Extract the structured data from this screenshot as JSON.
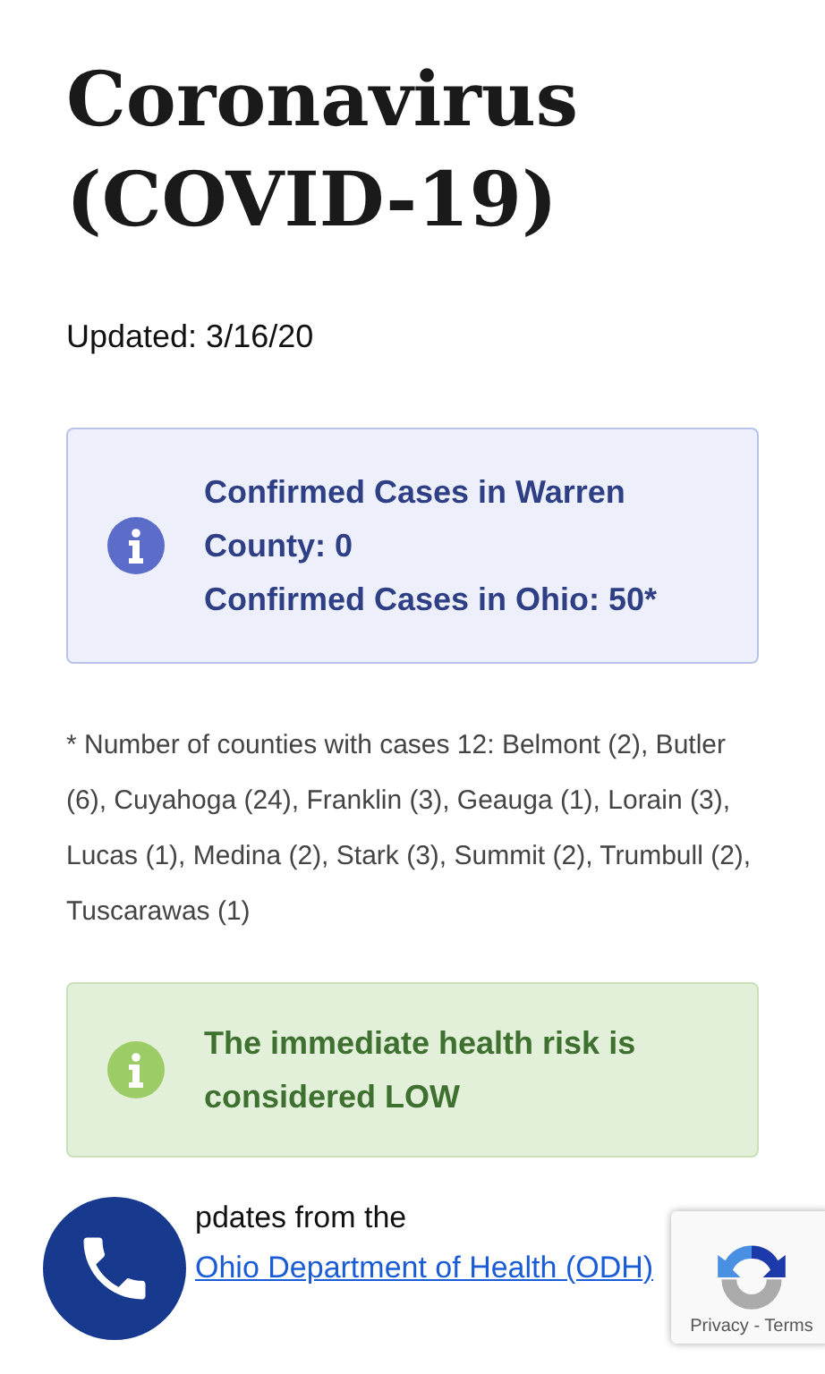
{
  "title": "Coronavirus (COVID-19)",
  "updated": "Updated: 3/16/20",
  "alerts": [
    {
      "kind": "info",
      "lines": [
        "Confirmed Cases in Warren County: 0",
        "Confirmed Cases in Ohio: 50*"
      ]
    },
    {
      "kind": "success",
      "lines": [
        "The immediate health risk is considered LOW"
      ]
    }
  ],
  "note": "* Number of counties with cases 12: Belmont (2), Butler (6), Cuyahoga (24), Franklin (3), Geauga (1), Lorain (3), Lucas (1), Medina (2), Stark (3), Summit (2), Trumbull (2), Tuscarawas (1)",
  "updates": {
    "text": "pdates from the",
    "link": "Ohio Department of Health (ODH)"
  },
  "recaptcha": {
    "links": "Privacy - Terms"
  }
}
